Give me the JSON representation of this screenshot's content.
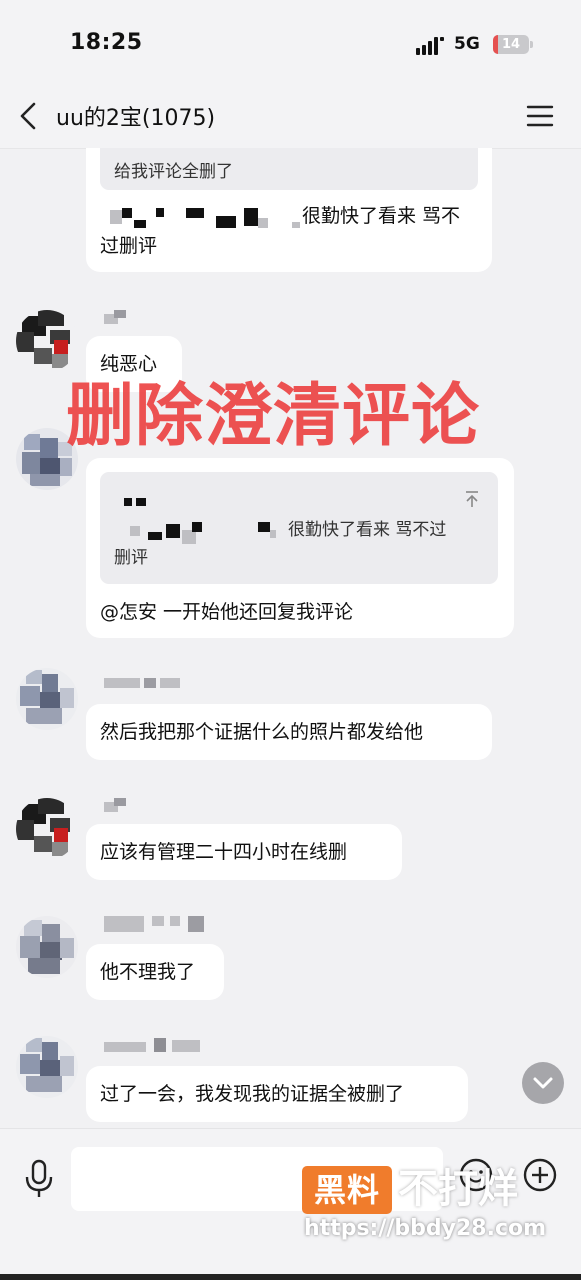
{
  "status_bar": {
    "time": "18:25",
    "network": "5G",
    "battery": "14"
  },
  "nav": {
    "title": "uu的2宝(1075)",
    "back_icon": "chevron-left-icon",
    "menu_icon": "hamburger-menu-icon"
  },
  "messages": [
    {
      "type": "text-with-quote",
      "quote": "给我评论全删了",
      "text_tail": "很勤快了看来 骂不",
      "text_line2": "过删评"
    },
    {
      "type": "text",
      "text": "纯恶心"
    },
    {
      "type": "text-with-quote",
      "quote_tail": "很勤快了看来 骂不过",
      "quote_line2": "删评",
      "text": "@怎安 一开始他还回复我评论"
    },
    {
      "type": "text",
      "text": "然后我把那个证据什么的照片都发给他"
    },
    {
      "type": "text",
      "text": "应该有管理二十四小时在线删"
    },
    {
      "type": "text",
      "text": "他不理我了"
    },
    {
      "type": "text",
      "text": "过了一会，我发现我的证据全被删了"
    }
  ],
  "overlay_caption": "删除澄清评论",
  "input_bar": {
    "voice_icon": "microphone-icon",
    "emoji_icon": "emoji-icon",
    "plus_icon": "plus-circle-icon",
    "placeholder": ""
  },
  "watermark": {
    "logo": "黑料",
    "brand": "不打烊",
    "url": "https://bbdy28.com"
  },
  "colors": {
    "background": "#f1f1f3",
    "bubble": "#ffffff",
    "quote": "#ececef",
    "overlay_red": "#ec3b3b",
    "logo_orange": "#f07c2c"
  }
}
